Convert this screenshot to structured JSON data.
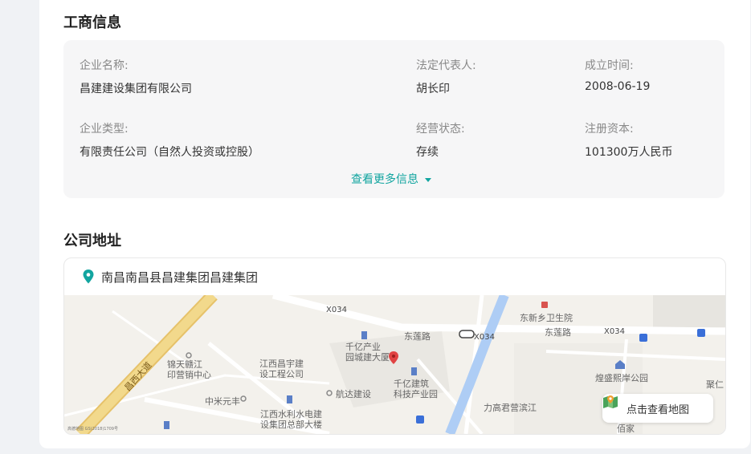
{
  "business_info": {
    "title": "工商信息",
    "fields": {
      "company_name": {
        "label": "企业名称:",
        "value": "昌建建设集团有限公司"
      },
      "legal_rep": {
        "label": "法定代表人:",
        "value": "胡长印"
      },
      "founded": {
        "label": "成立时间:",
        "value": "2008-06-19"
      },
      "company_type": {
        "label": "企业类型:",
        "value": "有限责任公司（自然人投资或控股）"
      },
      "status": {
        "label": "经营状态:",
        "value": "存续"
      },
      "capital": {
        "label": "注册资本:",
        "value": "101300万人民币"
      }
    },
    "more_link": "查看更多信息"
  },
  "address": {
    "title": "公司地址",
    "text": "南昌南昌县昌建集团昌建集团",
    "map_button": "点击查看地图",
    "map_labels": {
      "road_x034_a": "X034",
      "road_x034_b": "X034",
      "road_x034_c": "X034",
      "donglian_a": "东莲路",
      "donglian_b": "东莲路",
      "hospital": "东新乡卫生院",
      "qianyi_tower": "千亿产业\n园城建大厦",
      "qianyi_park": "千亿建筑\n科技产业园",
      "jiangxi_changyu": "江西昌宇建\n设工程公司",
      "jintian": "锦天赣江\n印营销中心",
      "zhongmi": "中米元丰",
      "hangda": "航达建设",
      "shuili": "江西水利水电建\n设集团总部大楼",
      "lilan": "力高君营滨江",
      "huangshan": "煌盛熙岸公园",
      "jurin": "聚仁",
      "road_diagonal": "昌西大道",
      "baixing": "佰家",
      "copyright": "高德地图 GS(2018)1709号"
    }
  },
  "colors": {
    "accent": "#12a5a0",
    "road_yellow": "#f2d98c",
    "river": "#aecdf5"
  }
}
